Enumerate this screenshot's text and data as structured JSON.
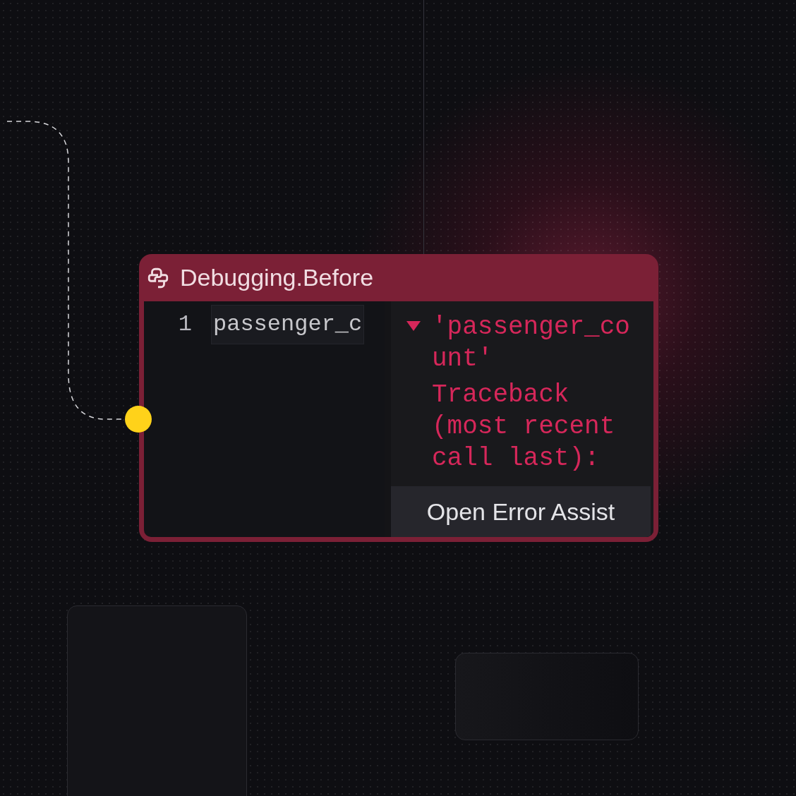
{
  "node": {
    "title": "Debugging.Before",
    "code_lines": [
      {
        "number": "1",
        "text": "passenger_c"
      }
    ],
    "error": {
      "expanded": true,
      "title": "'passenger_count'",
      "traceback": "Traceback (most recent call last):"
    },
    "button": "Open Error Assist"
  }
}
